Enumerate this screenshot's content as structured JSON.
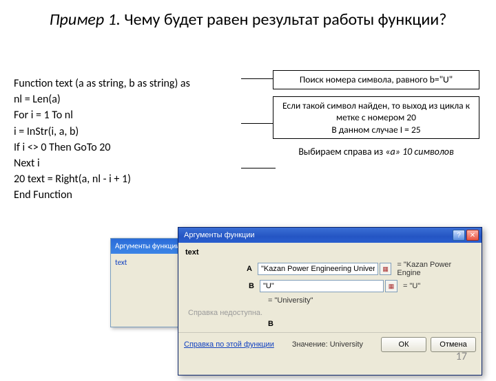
{
  "title": {
    "italic": "Пример 1.",
    "rest": " Чему будет равен результат работы функции?"
  },
  "code": {
    "l1": "Function text (a as string, b as string) as",
    "l2": "nl = Len(a)",
    "l3": "For i = 1 To nl",
    "l4": "i = InStr(i, a, b)",
    "l5": "If i <> 0 Then GoTo 20",
    "l6": "Next i",
    "l7": "20 text = Right(a, nl - i + 1)",
    "l8": "End Function"
  },
  "callouts": {
    "box1": "Поиск номера символа, равного b=\"U\"",
    "box2": "Если такой символ найден, то выход из цикла к метке с номером 20\nВ данном случае I = 25",
    "note_pre": "Выбираем справа из «",
    "note_em": "а» 10 символов"
  },
  "dialog_back": {
    "title": "Аргументы функции",
    "label": "text"
  },
  "dialog": {
    "title": "Аргументы функции",
    "fn": "text",
    "argA_label": "A",
    "argA_value": "\"Kazan Power Engineering University\"",
    "argA_rhs": "= \"Kazan Power Engine",
    "argB_label": "B",
    "argB_value": "\"U\"",
    "argB_rhs": "= \"U\"",
    "eq_result": "= \"University\"",
    "hint": "Справка недоступна.",
    "b_label": "B",
    "help_link": "Справка по этой функции",
    "value_label": "Значение:",
    "value": "University",
    "ok": "ОК",
    "cancel": "Отмена",
    "close_glyph": "✕",
    "help_glyph": "?"
  },
  "page_number": "17"
}
